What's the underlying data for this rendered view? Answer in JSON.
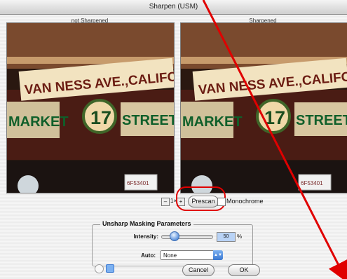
{
  "window": {
    "title": "Sharpen (USM)"
  },
  "preview": {
    "left_label": "not Sharpened",
    "right_label": "Sharpened",
    "image_texts": [
      "VAN NESS AVE.,CALIFORNIA",
      "MARKET",
      "17",
      "STREET",
      "6F53401"
    ]
  },
  "toolbar": {
    "zoom_minus": "–",
    "zoom_level": "1×",
    "zoom_plus": "+",
    "prescan_label": "Prescan",
    "monochrome_label": "Monochrome"
  },
  "params": {
    "title": "Unsharp Masking Parameters",
    "intensity_label": "Intensity:",
    "intensity_value": "50",
    "intensity_unit": "%",
    "intensity_fraction": 0.16,
    "auto_label": "Auto:",
    "auto_value": "None"
  },
  "footer": {
    "cancel_label": "Cancel",
    "ok_label": "OK"
  },
  "colors": {
    "accent": "#3a78d1",
    "annotation": "#e00000"
  }
}
